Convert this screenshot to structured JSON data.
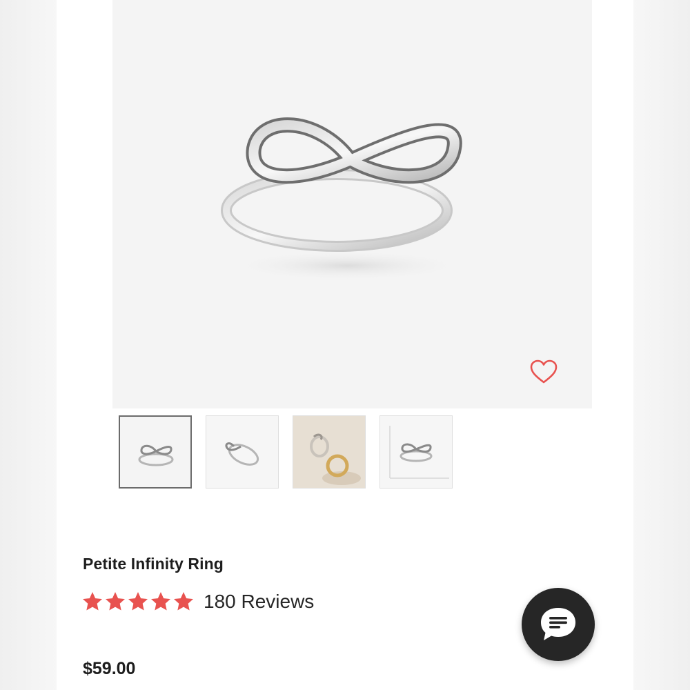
{
  "product": {
    "title": "Petite Infinity Ring",
    "rating": 5,
    "rating_max": 5,
    "reviews_label": "180 Reviews",
    "price": "$59.00"
  },
  "gallery": {
    "selected_index": 0,
    "thumbnails": [
      {
        "name": "front view"
      },
      {
        "name": "angle view"
      },
      {
        "name": "lifestyle view"
      },
      {
        "name": "size chart view"
      }
    ]
  },
  "colors": {
    "accent": "#e8524f",
    "chat_bg": "#262626",
    "hero_bg": "#f4f4f4"
  },
  "icons": {
    "wishlist": "heart-outline-icon",
    "rating": "star-icon",
    "chat": "chat-bubble-icon"
  }
}
